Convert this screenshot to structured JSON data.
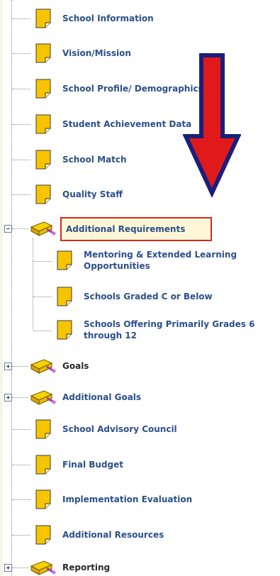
{
  "tree": {
    "items": [
      {
        "label": "School Information",
        "type": "doc"
      },
      {
        "label": "Vision/Mission",
        "type": "doc"
      },
      {
        "label": "School Profile/ Demographics",
        "type": "doc"
      },
      {
        "label": "Student Achievement Data",
        "type": "doc"
      },
      {
        "label": "School Match",
        "type": "doc"
      },
      {
        "label": "Quality Staff",
        "type": "doc"
      },
      {
        "label": "Additional Requirements",
        "type": "folder",
        "expanded": true,
        "selected": true,
        "children": [
          {
            "label": "Mentoring & Extended Learning Opportunities",
            "type": "doc"
          },
          {
            "label": "Schools Graded C or Below",
            "type": "doc"
          },
          {
            "label": "Schools Offering Primarily Grades 6 through 12",
            "type": "doc"
          }
        ]
      },
      {
        "label": "Goals",
        "type": "folder",
        "expanded": false
      },
      {
        "label": "Additional Goals",
        "type": "folder",
        "expanded": false
      },
      {
        "label": "School Advisory Council",
        "type": "doc"
      },
      {
        "label": "Final Budget",
        "type": "doc"
      },
      {
        "label": "Implementation Evaluation",
        "type": "doc"
      },
      {
        "label": "Additional Resources",
        "type": "doc"
      },
      {
        "label": "Reporting",
        "type": "folder",
        "expanded": false
      }
    ]
  },
  "annotation": {
    "type": "arrow-down",
    "color": "#e0191b",
    "outline": "#1a1f7a"
  },
  "colors": {
    "label": "#2c4f8a",
    "selection_border": "#d52a1a",
    "selection_fill": "#fdf7d8"
  }
}
